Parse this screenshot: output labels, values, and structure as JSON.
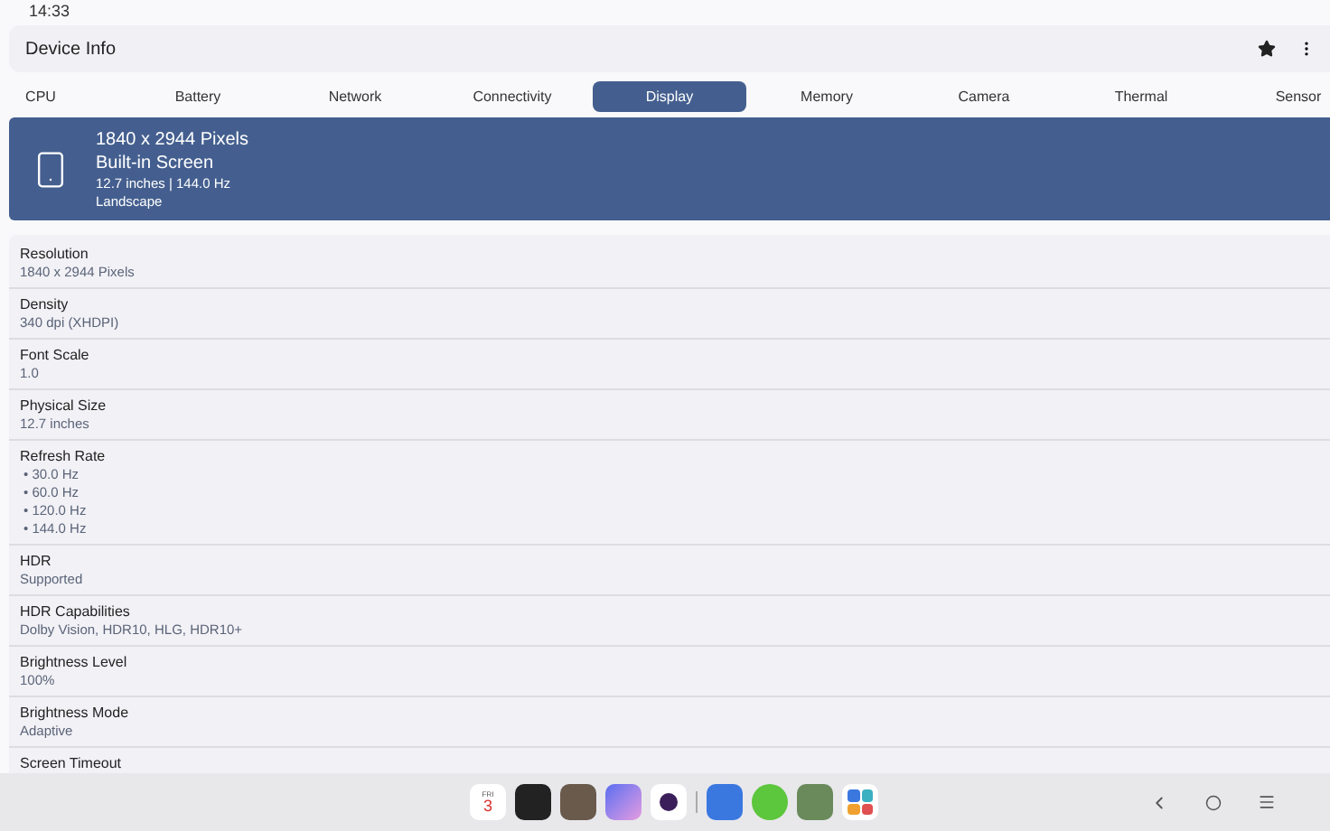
{
  "status_bar": {
    "time": "14:33"
  },
  "app_bar": {
    "title": "Device Info"
  },
  "tabs": [
    {
      "label": "CPU",
      "selected": false
    },
    {
      "label": "Battery",
      "selected": false
    },
    {
      "label": "Network",
      "selected": false
    },
    {
      "label": "Connectivity",
      "selected": false
    },
    {
      "label": "Display",
      "selected": true
    },
    {
      "label": "Memory",
      "selected": false
    },
    {
      "label": "Camera",
      "selected": false
    },
    {
      "label": "Thermal",
      "selected": false
    },
    {
      "label": "Sensor",
      "selected": false
    }
  ],
  "banner": {
    "title": "1840 x 2944 Pixels",
    "subtitle": "Built-in Screen",
    "details": "12.7 inches | 144.0 Hz",
    "orientation": "Landscape"
  },
  "rows": [
    {
      "kind": "text",
      "label": "Resolution",
      "value": "1840 x 2944 Pixels"
    },
    {
      "kind": "text",
      "label": "Density",
      "value": "340 dpi (XHDPI)"
    },
    {
      "kind": "text",
      "label": "Font Scale",
      "value": "1.0"
    },
    {
      "kind": "text",
      "label": "Physical Size",
      "value": "12.7 inches"
    },
    {
      "kind": "list",
      "label": "Refresh Rate",
      "items": [
        "• 30.0 Hz",
        "• 60.0 Hz",
        "• 120.0 Hz",
        "• 144.0 Hz"
      ]
    },
    {
      "kind": "text",
      "label": "HDR",
      "value": "Supported"
    },
    {
      "kind": "text",
      "label": "HDR Capabilities",
      "value": "Dolby Vision, HDR10, HLG, HDR10+"
    },
    {
      "kind": "text",
      "label": "Brightness Level",
      "value": "100%"
    },
    {
      "kind": "text",
      "label": "Brightness Mode",
      "value": "Adaptive"
    },
    {
      "kind": "text",
      "label": "Screen Timeout"
    }
  ],
  "dock": {
    "calendar": {
      "day": "FRI",
      "date": "3"
    }
  }
}
